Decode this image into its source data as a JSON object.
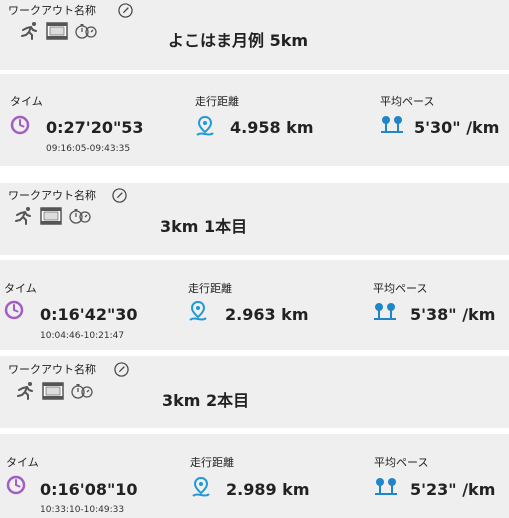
{
  "colors": {
    "panel_bg": "#efefef",
    "clock_purple": "#a25ec4",
    "distance_teal": "#1f9ad6",
    "pace_blue": "#1f86c8"
  },
  "icons": [
    "running-person-icon",
    "video-frame-icon",
    "stopwatch-icon",
    "pencil-icon",
    "clock-icon",
    "map-pin-route-icon",
    "pace-pins-icon"
  ],
  "workouts": [
    {
      "name_label": "ワークアウト名称",
      "title": "よこはま月例 5km",
      "time_label": "タイム",
      "time_value": "0:27'20\"53",
      "time_range": "09:16:05-09:43:35",
      "distance_label": "走行距離",
      "distance_value": "4.958 km",
      "pace_label": "平均ペース",
      "pace_value": "5'30\" /km"
    },
    {
      "name_label": "ワークアウト名称",
      "title": "3km 1本目",
      "time_label": "タイム",
      "time_value": "0:16'42\"30",
      "time_range": "10:04:46-10:21:47",
      "distance_label": "走行距離",
      "distance_value": "2.963 km",
      "pace_label": "平均ペース",
      "pace_value": "5'38\" /km"
    },
    {
      "name_label": "ワークアウト名称",
      "title": "3km 2本目",
      "time_label": "タイム",
      "time_value": "0:16'08\"10",
      "time_range": "10:33:10-10:49:33",
      "distance_label": "走行距離",
      "distance_value": "2.989 km",
      "pace_label": "平均ペース",
      "pace_value": "5'23\" /km"
    }
  ]
}
